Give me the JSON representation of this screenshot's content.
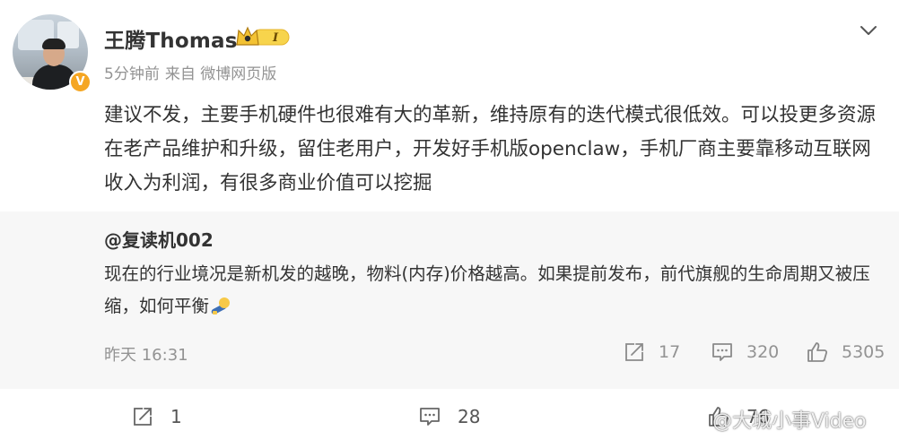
{
  "post": {
    "author": "王腾Thomas",
    "verified_badge": "V",
    "member_level": "I",
    "time": "5分钟前",
    "source": "来自 微博网页版",
    "text": "建议不发，主要手机硬件也很难有大的革新，维持原有的迭代模式很低效。可以投更多资源在老产品维护和升级，留住老用户，开发好手机版openclaw，手机厂商主要靠移动互联网收入为利润，有很多商业价值可以挖掘"
  },
  "retweet": {
    "author": "@复读机002",
    "text": "现在的行业境况是新机发的越晚，物料(内存)价格越高。如果提前发布，前代旗舰的生命周期又被压缩，如何平衡",
    "time": "昨天 16:31",
    "reposts": "17",
    "comments": "320",
    "likes": "5305"
  },
  "actions": {
    "reposts": "1",
    "comments": "28",
    "likes": "76"
  },
  "watermark": "@大城小事Video",
  "colors": {
    "text": "#333333",
    "meta": "#939393",
    "retweet_bg": "#f7f7f7",
    "badge": "#f5a623"
  },
  "icons": [
    "chevron-down-icon",
    "crown-level-icon",
    "repost-icon",
    "comment-icon",
    "like-icon",
    "weibo-logo-icon"
  ]
}
